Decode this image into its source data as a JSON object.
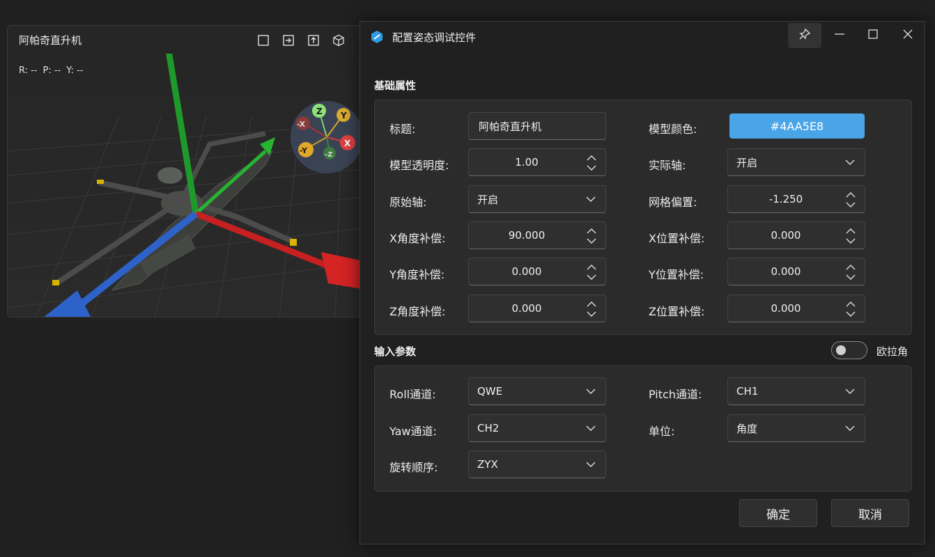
{
  "viewer": {
    "title": "阿帕奇直升机",
    "tools": [
      "frame-icon",
      "export-icon",
      "upload-icon",
      "cube-icon"
    ],
    "readout": {
      "r": "R: --",
      "p": "P: --",
      "y": "Y: --"
    },
    "gizmo": {
      "z": "Z",
      "y": "Y",
      "x": "X",
      "neg_x": "-X",
      "neg_y": "-Y",
      "neg_z": "-Z"
    }
  },
  "dialog": {
    "title": "配置姿态调试控件",
    "titlebar_buttons": [
      "pin-icon",
      "minimize-icon",
      "maximize-icon",
      "close-icon"
    ],
    "basic": {
      "section": "基础属性",
      "title_label": "标题:",
      "title_value": "阿帕奇直升机",
      "color_label": "模型颜色:",
      "color_value": "#4AA5E8",
      "opacity_label": "模型透明度:",
      "opacity_value": "1.00",
      "actual_axis_label": "实际轴:",
      "actual_axis_value": "开启",
      "origin_axis_label": "原始轴:",
      "origin_axis_value": "开启",
      "grid_offset_label": "网格偏置:",
      "grid_offset_value": "-1.250",
      "x_angle_label": "X角度补偿:",
      "x_angle_value": "90.000",
      "x_pos_label": "X位置补偿:",
      "x_pos_value": "0.000",
      "y_angle_label": "Y角度补偿:",
      "y_angle_value": "0.000",
      "y_pos_label": "Y位置补偿:",
      "y_pos_value": "0.000",
      "z_angle_label": "Z角度补偿:",
      "z_angle_value": "0.000",
      "z_pos_label": "Z位置补偿:",
      "z_pos_value": "0.000"
    },
    "input": {
      "section": "输入参数",
      "euler_label": "欧拉角",
      "euler_on": false,
      "roll_label": "Roll通道:",
      "roll_value": "QWE",
      "pitch_label": "Pitch通道:",
      "pitch_value": "CH1",
      "yaw_label": "Yaw通道:",
      "yaw_value": "CH2",
      "unit_label": "单位:",
      "unit_value": "角度",
      "order_label": "旋转顺序:",
      "order_value": "ZYX"
    },
    "ok_label": "确定",
    "cancel_label": "取消"
  },
  "colors": {
    "accent": "#4AA5E8",
    "background": "#202020",
    "panel": "#2b2b2b"
  }
}
